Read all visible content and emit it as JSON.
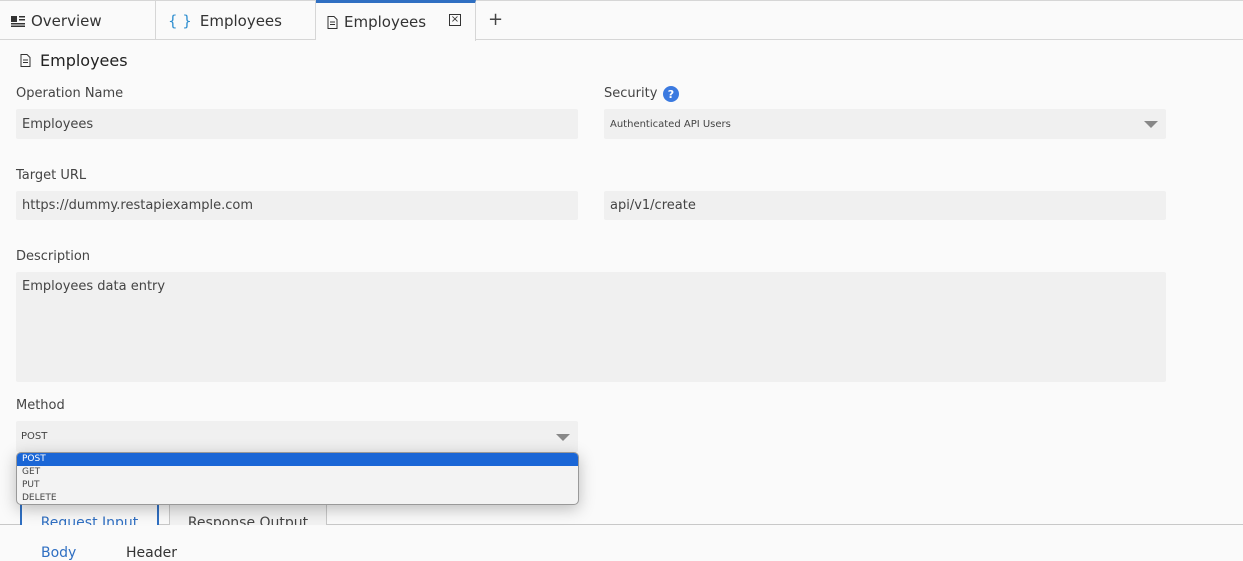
{
  "tabs": [
    {
      "label": "Overview"
    },
    {
      "label": "Employees"
    },
    {
      "label": "Employees"
    }
  ],
  "page": {
    "title": "Employees"
  },
  "form": {
    "operation_name": {
      "label": "Operation Name",
      "value": "Employees"
    },
    "security": {
      "label": "Security",
      "value": "Authenticated API Users"
    },
    "target_url": {
      "label": "Target URL",
      "base": "https://dummy.restapiexample.com",
      "path": "api/v1/create"
    },
    "description": {
      "label": "Description",
      "value": "Employees data entry"
    },
    "method": {
      "label": "Method",
      "value": "POST",
      "options": [
        "POST",
        "GET",
        "PUT",
        "DELETE"
      ]
    }
  },
  "section_tabs": [
    {
      "label": "Request Input"
    },
    {
      "label": "Response Output"
    }
  ],
  "bottom_tabs": [
    {
      "label": "Body"
    },
    {
      "label": "Header"
    }
  ],
  "colors": {
    "accent": "#2f6fc2",
    "selected_option": "#1a66d6",
    "help_icon": "#3b7ae0"
  }
}
